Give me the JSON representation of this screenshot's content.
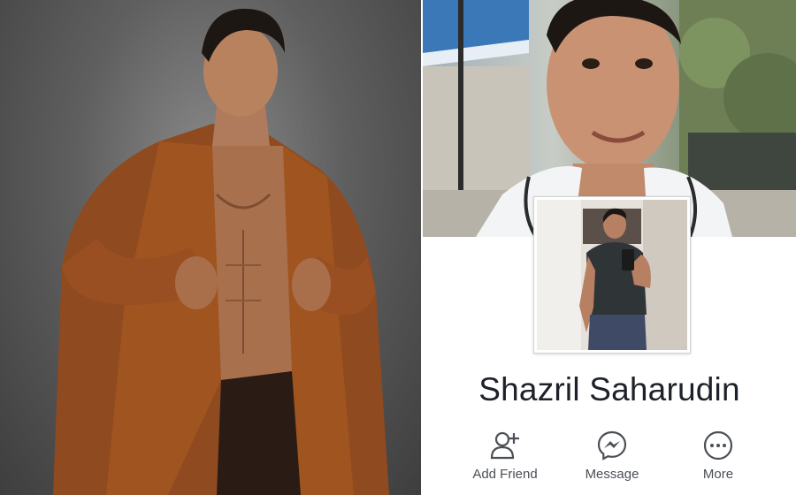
{
  "profile": {
    "name": "Shazril Saharudin"
  },
  "actions": {
    "add_friend": {
      "label": "Add Friend",
      "icon": "add-friend-icon"
    },
    "message": {
      "label": "Message",
      "icon": "messenger-icon"
    },
    "more": {
      "label": "More",
      "icon": "more-dots-icon"
    }
  },
  "colors": {
    "text": "#1d2129",
    "action_text": "#4b4f56",
    "icon": "#4b4f56",
    "jacket": "#9a4f22"
  }
}
